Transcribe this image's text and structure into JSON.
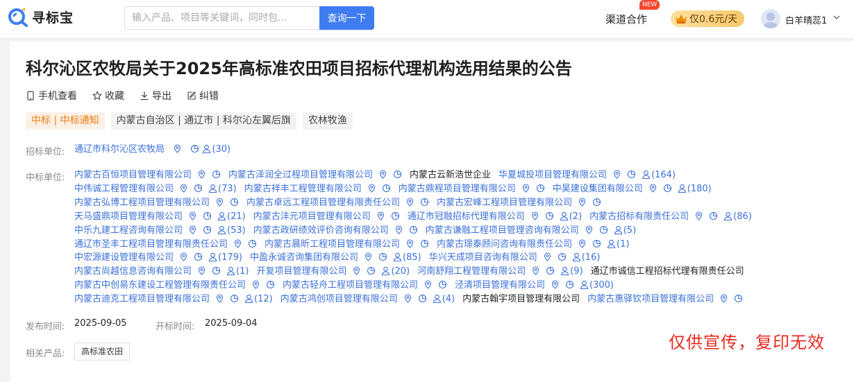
{
  "header": {
    "logo_text": "寻标宝",
    "search_placeholder": "输入产品、项目等关键词，同时包...",
    "search_button": "查询一下",
    "channel_label": "渠道合作",
    "new_badge": "NEW",
    "vip_label": "仅0.6元/天",
    "user_name": "白羊晴蕊1"
  },
  "notice": {
    "title": "科尔沁区农牧局关于2025年高标准农田项目招标代理机构选用结果的公告",
    "actions": [
      "手机查看",
      "收藏",
      "导出",
      "纠错"
    ],
    "tags": {
      "type": "中标 | 中标通知",
      "region": "内蒙古自治区 | 通辽市 | 科尔沁左翼后旗",
      "industry": "农林牧渔"
    },
    "tenderer_label": "招标单位:",
    "tenderer_name": "通辽市科尔沁区农牧局",
    "tenderer_count": "(30)",
    "winners_label": "中标单位:",
    "publish_label": "发布时间:",
    "publish_date": "2025-09-05",
    "open_label": "开标时间:",
    "open_date": "2025-09-04",
    "product_label": "相关产品:",
    "product_tag": "高标准农田",
    "watermark": "仅供宣传，复印无效"
  },
  "winners": [
    [
      {
        "name": "内蒙古百恒项目管理有限公司",
        "icons": true,
        "count": ""
      },
      {
        "name": "内蒙古泽润全过程项目管理有限公司",
        "icons": true,
        "count": ""
      },
      {
        "name": "内蒙古云新浩世企业",
        "icons": false,
        "count": "",
        "plain": true
      },
      {
        "name": "华夏城投项目管理有限公司",
        "icons": true,
        "count": "(164)"
      }
    ],
    [
      {
        "name": "中伟诚工程管理有限公司",
        "icons": true,
        "count": "(73)"
      },
      {
        "name": "内蒙古祥丰工程管理有限公司",
        "icons": true,
        "count": ""
      },
      {
        "name": "内蒙古鼎程项目管理有限公司",
        "icons": true,
        "count": ""
      },
      {
        "name": "中昊建设集团有限公司",
        "icons": true,
        "count": "(180)"
      }
    ],
    [
      {
        "name": "内蒙古弘博工程项目管理有限公司",
        "icons": true,
        "count": ""
      },
      {
        "name": "内蒙古卓远工程项目管理有限责任公司",
        "icons": true,
        "count": ""
      },
      {
        "name": "内蒙古宏峰工程项目管理有限公司",
        "icons": true,
        "count": ""
      }
    ],
    [
      {
        "name": "天马盛鼎项目管理有限公司",
        "icons": true,
        "count": "(21)"
      },
      {
        "name": "内蒙古沣元项目管理有限公司",
        "icons": true,
        "count": ""
      },
      {
        "name": "通辽市冠融招标代理有限公司",
        "icons": true,
        "count": "(2)"
      },
      {
        "name": "内蒙古招标有限责任公司",
        "icons": true,
        "count": "(86)"
      }
    ],
    [
      {
        "name": "中乐九建工程咨询有限公司",
        "icons": true,
        "count": "(53)"
      },
      {
        "name": "内蒙古政研绩效评价咨询有限公司",
        "icons": true,
        "count": ""
      },
      {
        "name": "内蒙古谦融工程项目管理咨询有限公司",
        "icons": true,
        "count": "(5)"
      }
    ],
    [
      {
        "name": "通辽市圣丰工程项目管理有限责任公司",
        "icons": true,
        "count": ""
      },
      {
        "name": "内蒙古晨昕工程项目管理有限公司",
        "icons": true,
        "count": ""
      },
      {
        "name": "内蒙古璟泰顾问咨询有限责任公司",
        "icons": true,
        "count": "(1)"
      }
    ],
    [
      {
        "name": "中宏源建设管理有限公司",
        "icons": true,
        "count": "(179)"
      },
      {
        "name": "中盈永诚咨询集团有限公司",
        "icons": true,
        "count": "(85)"
      },
      {
        "name": "华兴天成项目咨询有限公司",
        "icons": true,
        "count": "(16)"
      }
    ],
    [
      {
        "name": "内蒙古尚越信息咨询有限公司",
        "icons": true,
        "count": "(1)"
      },
      {
        "name": "开复项目管理有限公司",
        "icons": true,
        "count": "(20)"
      },
      {
        "name": "河南舒翔工程管理有限公司",
        "icons": true,
        "count": "(9)"
      },
      {
        "name": "通辽市诚信工程招标代理有限责任公司",
        "icons": false,
        "count": "",
        "plain": true
      }
    ],
    [
      {
        "name": "内蒙古中创易东建设工程管理有限责任公司",
        "icons": true,
        "count": ""
      },
      {
        "name": "内蒙古轻舟工程项目管理有限公司",
        "icons": true,
        "count": ""
      },
      {
        "name": "泾清项目管理有限公司",
        "icons": true,
        "count": "(300)"
      }
    ],
    [
      {
        "name": "内蒙古迪克工程项目管理有限公司",
        "icons": true,
        "count": "(12)"
      },
      {
        "name": "内蒙古鸿创项目管理有限公司",
        "icons": true,
        "count": "(4)"
      },
      {
        "name": "内蒙古翰宇项目管理有限公司",
        "icons": false,
        "count": "",
        "plain": true
      },
      {
        "name": "内蒙古惠驿钦项目管理有限公司",
        "icons": true,
        "count": ""
      }
    ]
  ],
  "colors": {
    "link": "#3a6fd8",
    "accent": "#3f7cf0",
    "tag_orange": "#f07a12",
    "watermark": "#e8281e"
  },
  "icon_names": [
    "search-magnifier-logo-icon",
    "phone-icon",
    "star-icon",
    "download-icon",
    "edit-icon",
    "location-icon",
    "pie-chart-icon",
    "user-icon",
    "crown-icon",
    "chevron-down-icon"
  ]
}
